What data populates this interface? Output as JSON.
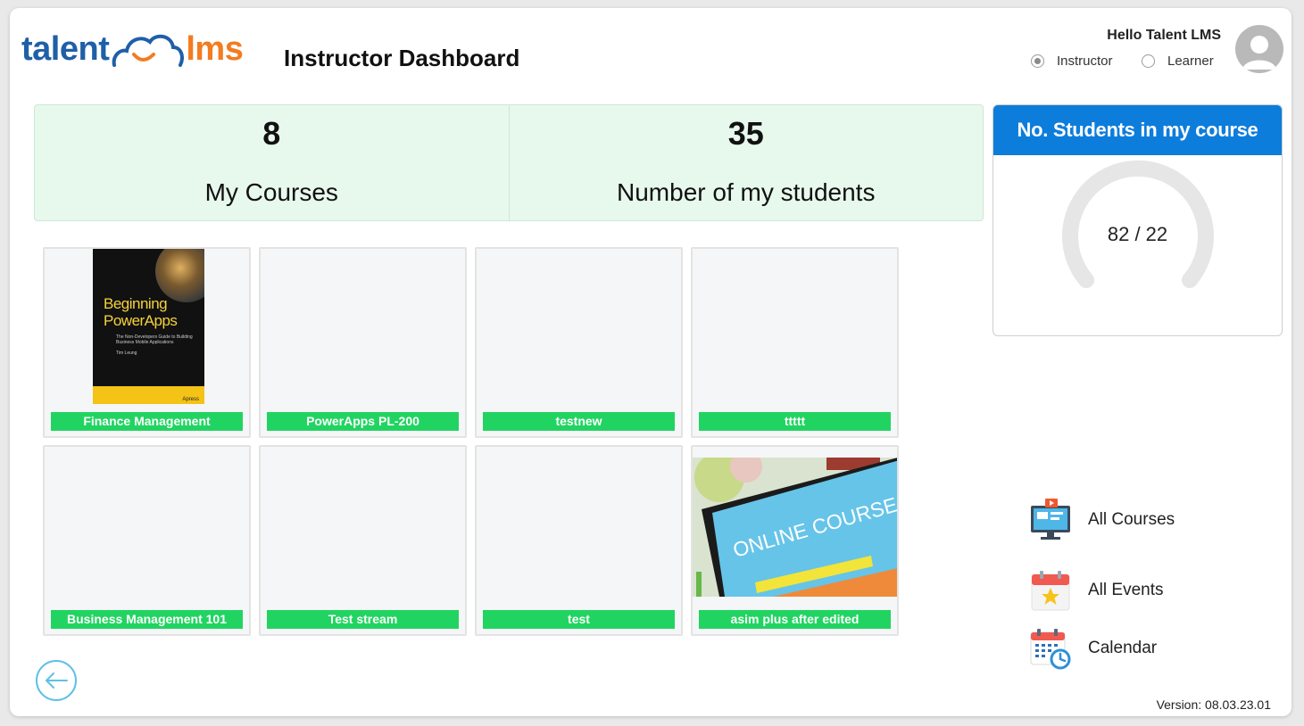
{
  "brand": {
    "name_left": "talent",
    "name_right": "lms",
    "accent_blue": "#1f5fa8",
    "accent_orange": "#f47b20"
  },
  "header": {
    "page_title": "Instructor Dashboard",
    "greeting": "Hello Talent LMS",
    "roles": [
      {
        "label": "Instructor",
        "selected": true
      },
      {
        "label": "Learner",
        "selected": false
      }
    ],
    "avatar_icon": "user-avatar-icon"
  },
  "stats": [
    {
      "value": "8",
      "label": "My Courses"
    },
    {
      "value": "35",
      "label": "Number of my students"
    }
  ],
  "students_card": {
    "title": "No. Students in my course",
    "gauge_text": "82 / 22",
    "gauge_value": 82,
    "gauge_max": 22,
    "header_color": "#0d7ddb"
  },
  "courses": [
    {
      "title": "Finance Management",
      "image": "book-cover-beginning-powerapps",
      "cover_title_1": "Beginning",
      "cover_title_2": "PowerApps",
      "cover_subtitle": "The Non-Developers Guide to Building Business Mobile Applications",
      "cover_author": "Tim Leung",
      "cover_publisher": "Apress"
    },
    {
      "title": "PowerApps PL-200",
      "image": ""
    },
    {
      "title": "testnew",
      "image": ""
    },
    {
      "title": "ttttt",
      "image": ""
    },
    {
      "title": "Business Management 101",
      "image": ""
    },
    {
      "title": "Test stream",
      "image": ""
    },
    {
      "title": "test",
      "image": ""
    },
    {
      "title": "asim plus after edited",
      "image": "online-courses-tablet",
      "image_text": "ONLINE COURSES"
    }
  ],
  "course_label_color": "#21d461",
  "quick_links": [
    {
      "label": "All Courses",
      "icon": "monitor-video-icon"
    },
    {
      "label": "All Events",
      "icon": "calendar-star-icon"
    },
    {
      "label": "Calendar",
      "icon": "calendar-clock-icon"
    }
  ],
  "back_icon": "arrow-left-circle-icon",
  "version": "Version: 08.03.23.01"
}
